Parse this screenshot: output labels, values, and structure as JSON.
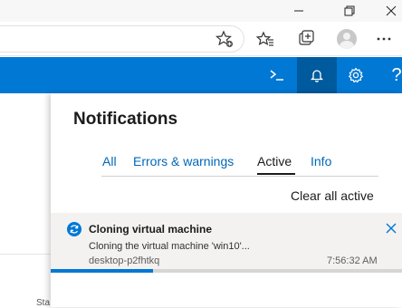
{
  "window_controls": {
    "minimize_icon": "minimize-icon",
    "maximize_icon": "restore-icon",
    "close_icon": "close-icon"
  },
  "browser_toolbar": {
    "icons": [
      "add-favorite-icon",
      "favorites-icon",
      "collections-icon",
      "profile-icon",
      "more-icon"
    ]
  },
  "azure_bar": {
    "color": "#0078d4",
    "shell_icon": "cloud-shell-icon",
    "bell_icon": "bell-icon",
    "gear_icon": "gear-icon",
    "help_label": "?"
  },
  "background_page": {
    "partial_text": "Sta"
  },
  "notifications": {
    "title": "Notifications",
    "tabs": [
      {
        "label": "All",
        "active": false
      },
      {
        "label": "Errors & warnings",
        "active": false
      },
      {
        "label": "Active",
        "active": true
      },
      {
        "label": "Info",
        "active": false
      }
    ],
    "clear_all_label": "Clear all active",
    "items": [
      {
        "title": "Cloning virtual machine",
        "description": "Cloning the virtual machine 'win10'...",
        "source": "desktop-p2fhtkq",
        "time": "7:56:32 AM",
        "progress": 0.29,
        "status_icon": "in-progress-icon"
      }
    ]
  }
}
